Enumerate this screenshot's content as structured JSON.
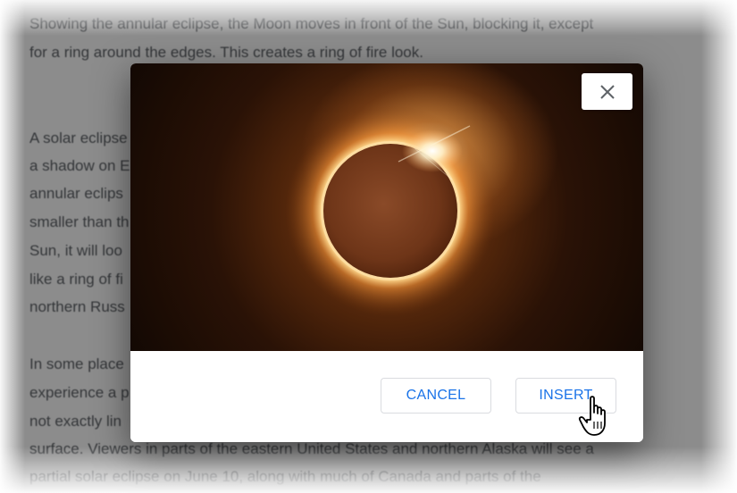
{
  "document": {
    "lines": [
      "Showing the annular eclipse, the Moon moves in front of the Sun, blocking it, except",
      "for a ring around the edges. This creates a ring of fire look.",
      "A solar eclipse",
      "a shadow on E",
      "annular eclips",
      "smaller than th",
      "Sun, it will loo",
      "like a ring of fi",
      "northern Russ",
      "In some place",
      "experience a p",
      "not exactly lin",
      "surface. Viewers in parts of the eastern United States and northern Alaska will see a",
      "partial solar eclipse on June 10, along with much of Canada and parts of the"
    ]
  },
  "dialog": {
    "image_alt": "annular solar eclipse",
    "close_icon": "close-icon",
    "cancel_label": "CANCEL",
    "insert_label": "INSERT"
  },
  "colors": {
    "accent": "#1a73e8",
    "border": "#dadce0",
    "text_muted": "#5f6368"
  }
}
